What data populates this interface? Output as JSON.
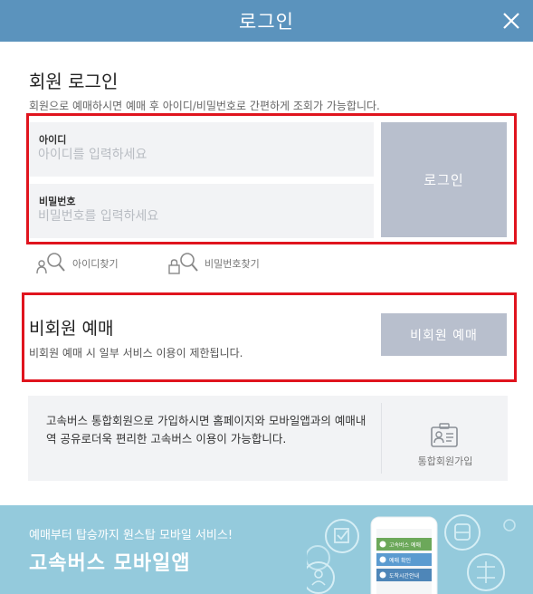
{
  "header": {
    "title": "로그인"
  },
  "member": {
    "title": "회원 로그인",
    "desc": "회원으로 예매하시면 예매 후 아이디/비밀번호로 간편하게 조회가 가능합니다.",
    "id_label": "아이디",
    "id_placeholder": "아이디를 입력하세요",
    "pw_label": "비밀번호",
    "pw_placeholder": "비밀번호를 입력하세요",
    "login_button": "로그인",
    "find_id": "아이디찾기",
    "find_pw": "비밀번호찾기"
  },
  "guest": {
    "title": "비회원 예매",
    "desc": "비회원 예매 시 일부 서비스 이용이 제한됩니다.",
    "button": "비회원 예매"
  },
  "integrated": {
    "text": "고속버스 통합회원으로 가입하시면 홈페이지와 모바일앱과의 예매내역 공유로더욱 편리한 고속버스 이용이 가능합니다.",
    "join_label": "통합회원가입"
  },
  "banner": {
    "subtitle": "예매부터 탑승까지 원스탑 모바일 서비스!",
    "title": "고속버스 모바일앱",
    "phone_menu": [
      "고속버스 예매",
      "예매 확인",
      "도착시간안내"
    ]
  },
  "colors": {
    "header": "#5b93bd",
    "highlight_border": "#e0141e",
    "button": "#b8bfcd",
    "banner": "#94cadc"
  },
  "icons": [
    "close-icon",
    "user-search-icon",
    "lock-search-icon",
    "id-card-icon",
    "mobile-phone-icon",
    "ticket-icon",
    "bus-icon",
    "user-circle-icon",
    "network-icon"
  ]
}
